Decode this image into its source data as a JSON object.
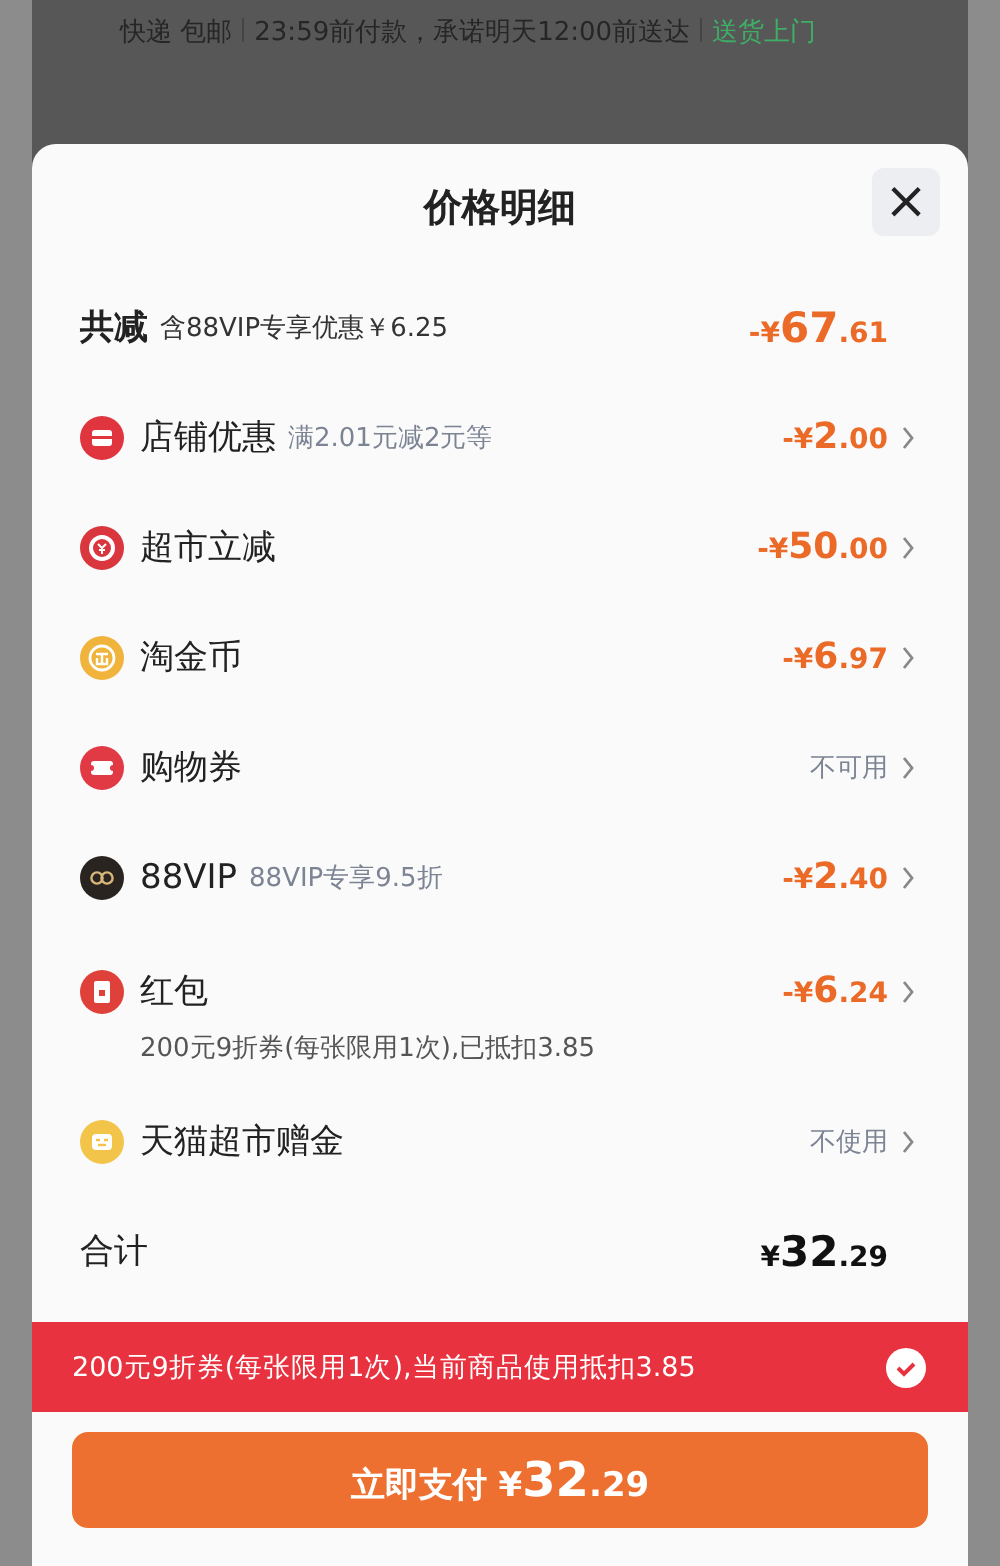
{
  "background_page": {
    "delivery": [
      "快递",
      "包邮",
      "23:59前付款，承诺明天12:00前送达"
    ],
    "delivery_tag": "送货上门"
  },
  "sheet": {
    "title": "价格明细",
    "close": "×",
    "total_discount": {
      "label": "共减",
      "note": "含88VIP专享优惠￥6.25",
      "amount": "-¥67.61"
    },
    "rows": [
      {
        "label": "店铺优惠",
        "note": "满2.01元减2元等",
        "kind": "amount",
        "value": "-¥2.00",
        "color": "#e0343f"
      },
      {
        "label": "超市立减",
        "kind": "amount",
        "value": "-¥50.00",
        "color": "#d9363e"
      },
      {
        "label": "淘金币",
        "kind": "amount",
        "value": "-¥6.97",
        "color": "#f0b43c"
      },
      {
        "label": "购物券",
        "kind": "status",
        "value": "不可用",
        "color": "#e23a44"
      },
      {
        "label": "88VIP",
        "note": "88VIP专享9.5折",
        "kind": "amount",
        "value": "-¥2.40",
        "color": "#2a2420"
      },
      {
        "label": "红包",
        "kind": "amount",
        "value": "-¥6.24",
        "detail": "200元9折券(每张限用1次),已抵扣3.85",
        "color": "#e0403a"
      },
      {
        "label": "天猫超市赠金",
        "kind": "status",
        "value": "不使用",
        "color": "#f2c54a"
      }
    ],
    "total": {
      "label": "合计",
      "amount": "¥32.29"
    },
    "coupon_banner": {
      "text": "200元9折券(每张限用1次),当前商品使用抵扣3.85",
      "checked": true
    },
    "pay_button": {
      "label": "立即支付",
      "amount": "¥32.29"
    }
  }
}
